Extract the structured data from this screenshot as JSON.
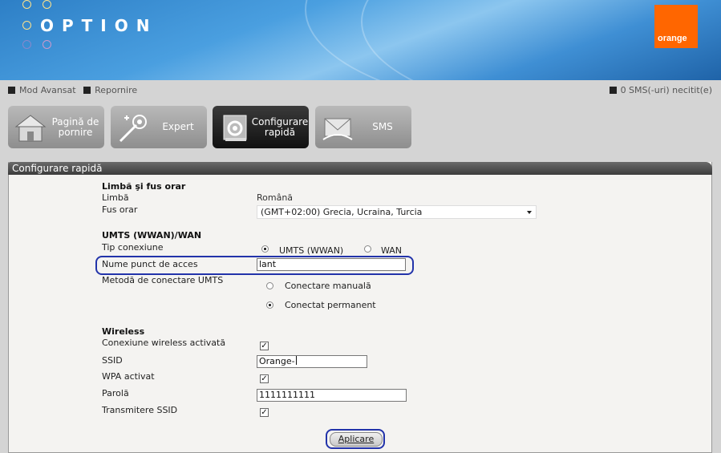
{
  "header": {
    "brand": "OPTION",
    "operator_logo": "orange"
  },
  "topbar": {
    "links": [
      "Mod Avansat",
      "Repornire"
    ],
    "sms_status": "0 SMS(-uri) necitit(e)"
  },
  "nav": [
    {
      "label": "Pagină de pornire",
      "icon": "house-icon",
      "active": false
    },
    {
      "label": "Expert",
      "icon": "wand-icon",
      "active": false
    },
    {
      "label": "Configurare rapidă",
      "icon": "settings-icon",
      "active": true
    },
    {
      "label": "SMS",
      "icon": "envelope-icon",
      "active": false
    }
  ],
  "panel": {
    "title": "Configurare rapidă",
    "lang_section": {
      "heading": "Limbă şi fus orar",
      "language_label": "Limbă",
      "language_value": "Română",
      "timezone_label": "Fus orar",
      "timezone_value": "(GMT+02:00) Grecia, Ucraina, Turcia"
    },
    "wan_section": {
      "heading": "UMTS (WWAN)/WAN",
      "conn_type_label": "Tip conexiune",
      "conn_type_options": [
        "UMTS (WWAN)",
        "WAN"
      ],
      "apn_label": "Nume punct de acces",
      "apn_value": "lant",
      "method_label": "Metodă de conectare UMTS",
      "method_options": [
        "Conectare manuală",
        "Conectat permanent"
      ]
    },
    "wireless_section": {
      "heading": "Wireless",
      "enabled_label": "Conexiune wireless activată",
      "ssid_label": "SSID",
      "ssid_value": "Orange-",
      "wpa_label": "WPA activat",
      "password_label": "Parolă",
      "password_value": "1111111111",
      "broadcast_label": "Transmitere SSID"
    },
    "apply_label": "Aplicare"
  },
  "colors": {
    "highlight": "#2233aa",
    "orange": "#ff6600"
  }
}
